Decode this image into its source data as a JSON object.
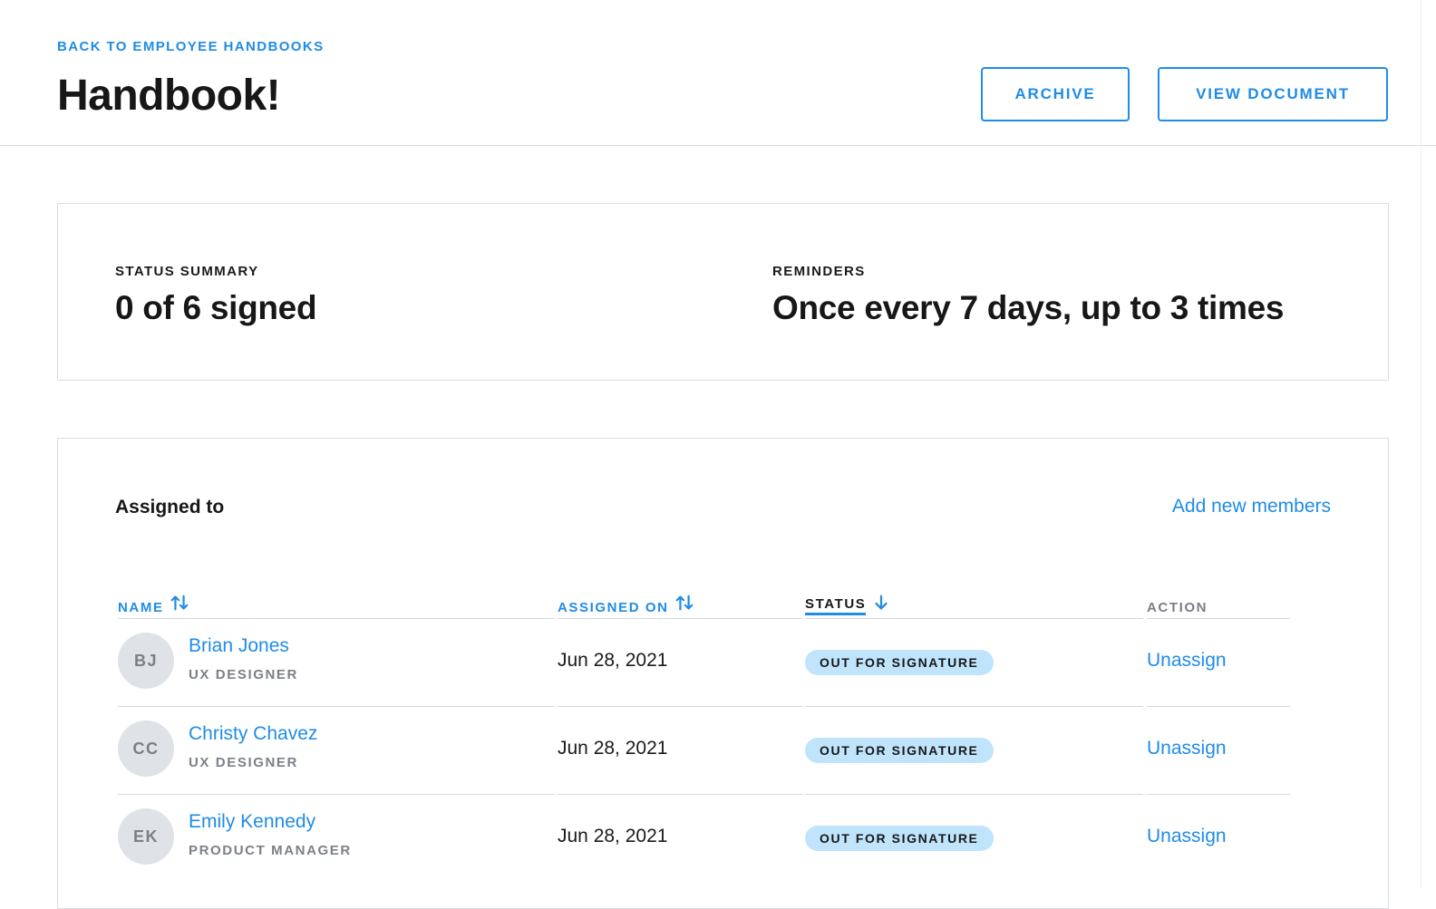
{
  "header": {
    "back_link": "BACK TO EMPLOYEE HANDBOOKS",
    "title": "Handbook!",
    "archive_label": "ARCHIVE",
    "view_document_label": "VIEW DOCUMENT"
  },
  "summary": {
    "status_label": "STATUS SUMMARY",
    "status_value": "0 of 6 signed",
    "reminders_label": "REMINDERS",
    "reminders_value": "Once every 7 days, up to 3 times"
  },
  "assigned": {
    "title": "Assigned to",
    "add_link": "Add new members",
    "columns": {
      "name": "NAME",
      "assigned_on": "ASSIGNED ON",
      "status": "STATUS",
      "action": "ACTION"
    },
    "rows": [
      {
        "initials": "BJ",
        "name": "Brian Jones",
        "role": "UX DESIGNER",
        "assigned_on": "Jun 28, 2021",
        "status": "OUT FOR SIGNATURE",
        "action": "Unassign"
      },
      {
        "initials": "CC",
        "name": "Christy Chavez",
        "role": "UX DESIGNER",
        "assigned_on": "Jun 28, 2021",
        "status": "OUT FOR SIGNATURE",
        "action": "Unassign"
      },
      {
        "initials": "EK",
        "name": "Emily Kennedy",
        "role": "PRODUCT MANAGER",
        "assigned_on": "Jun 28, 2021",
        "status": "OUT FOR SIGNATURE",
        "action": "Unassign"
      }
    ]
  },
  "icons": {
    "name_sort": "sort-both-icon",
    "assigned_sort": "sort-both-icon",
    "status_sort": "arrow-down-icon"
  },
  "colors": {
    "accent": "#1f8ce6",
    "badge_bg": "#bfe4fb",
    "avatar_bg": "#dfe2e6"
  }
}
